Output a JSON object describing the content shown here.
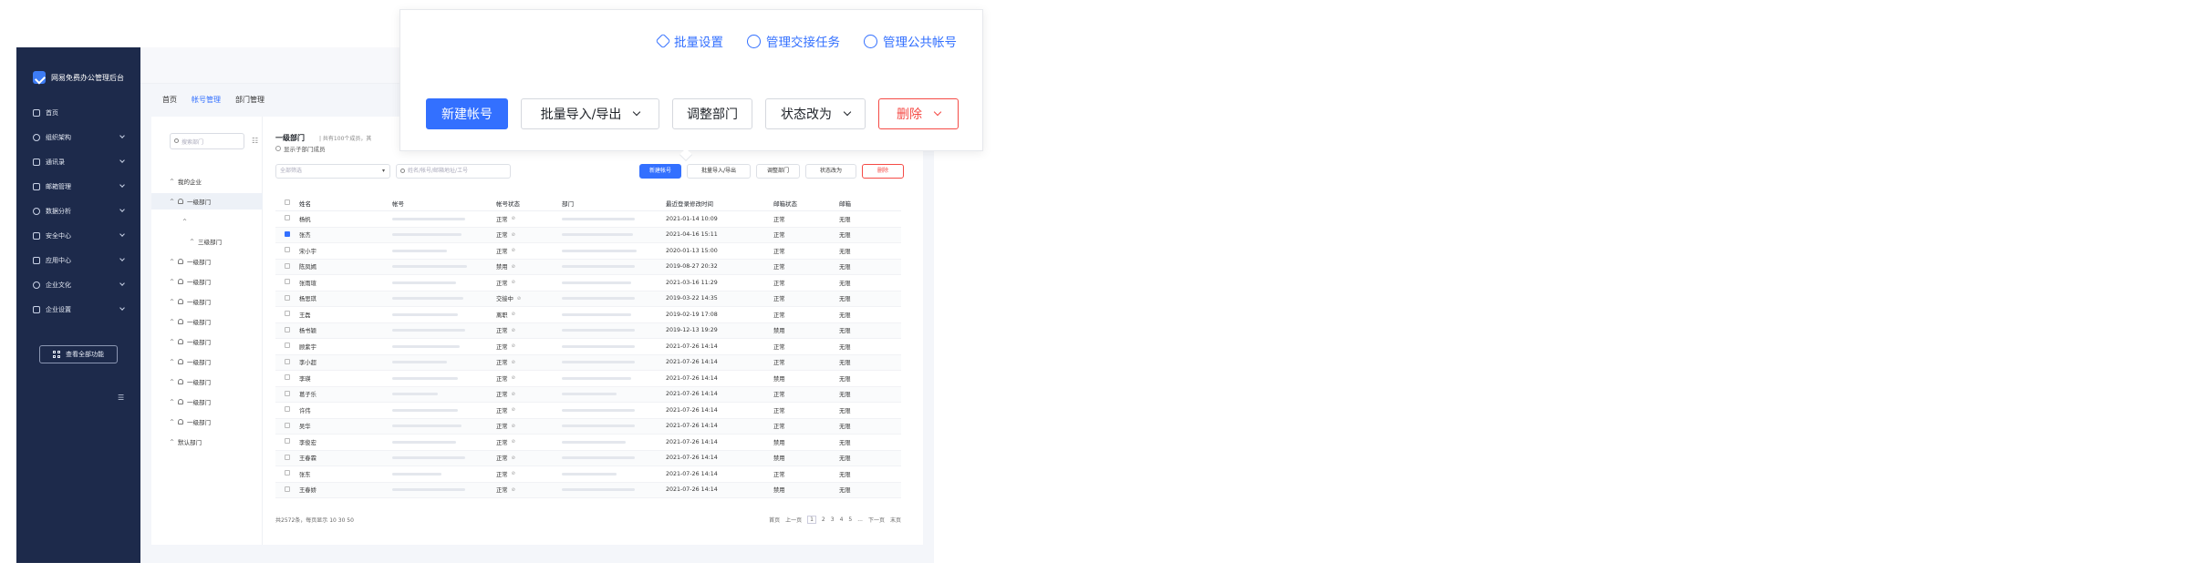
{
  "brand": {
    "name": "网易免费办公管理后台"
  },
  "sidebar": {
    "items": [
      {
        "label": "首页",
        "chev": false
      },
      {
        "label": "组织架构",
        "chev": true
      },
      {
        "label": "通讯录",
        "chev": true
      },
      {
        "label": "邮箱管理",
        "chev": true
      },
      {
        "label": "数据分析",
        "chev": true
      },
      {
        "label": "安全中心",
        "chev": true
      },
      {
        "label": "应用中心",
        "chev": true
      },
      {
        "label": "企业文化",
        "chev": true
      },
      {
        "label": "企业设置",
        "chev": true
      }
    ],
    "all_features": "查看全部功能"
  },
  "tabs": [
    {
      "label": "首页",
      "active": false
    },
    {
      "label": "帐号管理",
      "active": true
    },
    {
      "label": "部门管理",
      "active": false
    }
  ],
  "tree": {
    "search_placeholder": "搜索部门",
    "nodes": [
      {
        "label": "我的企业",
        "arrow": "^",
        "icon": false,
        "indent": 0
      },
      {
        "label": "一级部门",
        "arrow": "^",
        "icon": true,
        "indent": 0,
        "selected": true
      },
      {
        "label": "",
        "arrow": "^",
        "icon": false,
        "indent": 14
      },
      {
        "label": "三级部门",
        "arrow": "^",
        "icon": false,
        "indent": 22
      },
      {
        "label": "一级部门",
        "arrow": "^",
        "icon": true,
        "indent": 0
      },
      {
        "label": "一级部门",
        "arrow": "^",
        "icon": true,
        "indent": 0
      },
      {
        "label": "一级部门",
        "arrow": "^",
        "icon": true,
        "indent": 0
      },
      {
        "label": "一级部门",
        "arrow": "^",
        "icon": true,
        "indent": 0
      },
      {
        "label": "一级部门",
        "arrow": "^",
        "icon": true,
        "indent": 0
      },
      {
        "label": "一级部门",
        "arrow": "^",
        "icon": true,
        "indent": 0
      },
      {
        "label": "一级部门",
        "arrow": "^",
        "icon": true,
        "indent": 0
      },
      {
        "label": "一级部门",
        "arrow": "^",
        "icon": true,
        "indent": 0
      },
      {
        "label": "一级部门",
        "arrow": "^",
        "icon": true,
        "indent": 0
      },
      {
        "label": "默认部门",
        "arrow": "^",
        "icon": false,
        "indent": 0
      }
    ]
  },
  "content": {
    "dept_title": "一级部门",
    "dept_info": "| 共有100个成员，其",
    "show_child": "显示子部门成员",
    "filter_select": "全部筛选",
    "search_placeholder": "姓名/帐号/邮箱地址/工号",
    "buttons": {
      "new": "新建帐号",
      "import": "批量导入/导出",
      "adjust": "调整部门",
      "state": "状态改为",
      "delete": "删除"
    }
  },
  "table": {
    "headers": [
      "姓名",
      "帐号",
      "帐号状态",
      "部门",
      "最近登录修改时间",
      "邮箱状态",
      "邮箱"
    ],
    "rows": [
      {
        "name": "杨帆",
        "state": "正常",
        "time": "2021-01-14 10:09",
        "mstate": "正常",
        "mail": "无限",
        "checked": false,
        "acct": 80,
        "dept": 80
      },
      {
        "name": "张杰",
        "state": "正常",
        "time": "2021-04-16 15:11",
        "mstate": "正常",
        "mail": "无限",
        "checked": true,
        "acct": 76,
        "dept": 78
      },
      {
        "name": "宋小宇",
        "state": "正常",
        "time": "2020-01-13 15:00",
        "mstate": "正常",
        "mail": "无限",
        "checked": false,
        "acct": 60,
        "dept": 82
      },
      {
        "name": "陈凤嫣",
        "state": "禁用",
        "time": "2019-08-27 20:32",
        "mstate": "正常",
        "mail": "无限",
        "checked": false,
        "acct": 82,
        "dept": 80
      },
      {
        "name": "张雨瑄",
        "state": "正常",
        "time": "2021-03-16 11:29",
        "mstate": "正常",
        "mail": "无限",
        "checked": false,
        "acct": 70,
        "dept": 76
      },
      {
        "name": "杨思琪",
        "state": "交接中",
        "time": "2019-03-22 14:35",
        "mstate": "正常",
        "mail": "无限",
        "checked": false,
        "acct": 78,
        "dept": 80
      },
      {
        "name": "王磊",
        "state": "离职",
        "time": "2019-02-19 17:08",
        "mstate": "正常",
        "mail": "无限",
        "checked": false,
        "acct": 72,
        "dept": 76
      },
      {
        "name": "杨书颖",
        "state": "正常",
        "time": "2019-12-13 19:29",
        "mstate": "禁用",
        "mail": "无限",
        "checked": false,
        "acct": 80,
        "dept": 80
      },
      {
        "name": "顾紫宇",
        "state": "正常",
        "time": "2021-07-26 14:14",
        "mstate": "正常",
        "mail": "无限",
        "checked": false,
        "acct": 74,
        "dept": 80
      },
      {
        "name": "李小超",
        "state": "正常",
        "time": "2021-07-26 14:14",
        "mstate": "正常",
        "mail": "无限",
        "checked": false,
        "acct": 60,
        "dept": 80
      },
      {
        "name": "李瑛",
        "state": "正常",
        "time": "2021-07-26 14:14",
        "mstate": "禁用",
        "mail": "无限",
        "checked": false,
        "acct": 72,
        "dept": 76
      },
      {
        "name": "葛子乐",
        "state": "正常",
        "time": "2021-07-26 14:14",
        "mstate": "正常",
        "mail": "无限",
        "checked": false,
        "acct": 50,
        "dept": 60
      },
      {
        "name": "许伟",
        "state": "正常",
        "time": "2021-07-26 14:14",
        "mstate": "正常",
        "mail": "无限",
        "checked": false,
        "acct": 72,
        "dept": 80
      },
      {
        "name": "吴华",
        "state": "正常",
        "time": "2021-07-26 14:14",
        "mstate": "正常",
        "mail": "无限",
        "checked": false,
        "acct": 76,
        "dept": 80
      },
      {
        "name": "李俊宏",
        "state": "正常",
        "time": "2021-07-26 14:14",
        "mstate": "禁用",
        "mail": "无限",
        "checked": false,
        "acct": 70,
        "dept": 70
      },
      {
        "name": "王春霖",
        "state": "正常",
        "time": "2021-07-26 14:14",
        "mstate": "禁用",
        "mail": "无限",
        "checked": false,
        "acct": 80,
        "dept": 80
      },
      {
        "name": "张东",
        "state": "正常",
        "time": "2021-07-26 14:14",
        "mstate": "正常",
        "mail": "无限",
        "checked": false,
        "acct": 54,
        "dept": 60
      },
      {
        "name": "王春娇",
        "state": "正常",
        "time": "2021-07-26 14:14",
        "mstate": "禁用",
        "mail": "无限",
        "checked": false,
        "acct": 80,
        "dept": 80
      }
    ]
  },
  "footer": {
    "total": "共2572条，每页显示",
    "page_size": "30",
    "page_size_opts": "10  30  50",
    "pager": [
      "首页",
      "上一页",
      "1",
      "2",
      "3",
      "4",
      "5",
      "...",
      "下一页",
      "末页"
    ],
    "current": "1"
  },
  "zoom": {
    "links": [
      {
        "label": "批量设置",
        "icon": "settings-hex-icon"
      },
      {
        "label": "管理交接任务",
        "icon": "refresh-icon"
      },
      {
        "label": "管理公共帐号",
        "icon": "user-circle-icon"
      }
    ],
    "buttons": {
      "new": "新建帐号",
      "import": "批量导入/导出",
      "adjust": "调整部门",
      "state": "状态改为",
      "delete": "删除"
    }
  },
  "colors": {
    "primary": "#3370ff",
    "danger": "#f54a45",
    "sidebar": "#1d2a4b"
  }
}
